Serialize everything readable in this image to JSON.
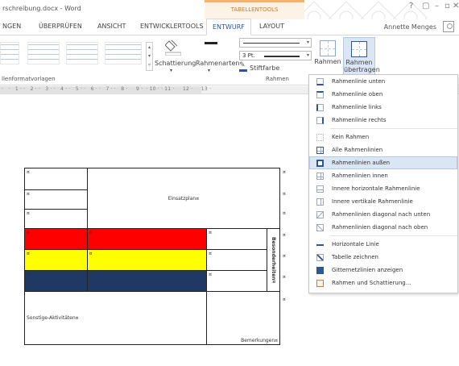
{
  "window": {
    "title": "rschreibung.docx - Word",
    "context_group": "TABELLENTOOLS",
    "controls": [
      "?",
      "▢",
      "–",
      "▫",
      "✕"
    ]
  },
  "tabs": [
    {
      "label": "NGEN"
    },
    {
      "label": "ÜBERPRÜFEN"
    },
    {
      "label": "ANSICHT"
    },
    {
      "label": "ENTWICKLERTOOLS"
    },
    {
      "label": "ENTWURF",
      "active": true
    },
    {
      "label": "LAYOUT"
    }
  ],
  "user": {
    "name": "Annette Menges"
  },
  "ribbon": {
    "shading_label": "Schattierung",
    "border_styles_label": "Rahmenarten",
    "line_weight": "3 Pt.",
    "pen_color_label": "Stiftfarbe",
    "borders_label": "Rahmen",
    "border_painter_label": "Rahmen übertragen",
    "group_styles": "llenformatvorlagen",
    "group_borders": "Rahmen",
    "colors": {
      "accent": "#2b579a",
      "context": "#f6b26b"
    }
  },
  "ruler": {
    "text": "·   ·   1 · ·   2 · ·   3 · ·   4 · ·   5 · ·   6 · ·   7 · ·   8 ·     9 ·  · 10 · · 11 ·     12 ·     13 ·"
  },
  "document": {
    "cell_mark": "¤",
    "title": "Einsatzplan¤",
    "side_label": "Besonderheiten¤",
    "activities": "Sonstige-Aktivitäten¤",
    "remarks": "Bemerkungen¤",
    "row_colors": [
      "#ff0000",
      "#ffff00",
      "#1f3864"
    ]
  },
  "menu": {
    "items": [
      {
        "label": "Rahmenlinie unten",
        "icon": "border-bottom-icon"
      },
      {
        "label": "Rahmenlinie oben",
        "icon": "border-top-icon"
      },
      {
        "label": "Rahmenlinie links",
        "icon": "border-left-icon"
      },
      {
        "label": "Rahmenlinie rechts",
        "icon": "border-right-icon"
      },
      {
        "label": "Kein Rahmen",
        "icon": "no-border-icon"
      },
      {
        "label": "Alle Rahmenlinien",
        "icon": "all-borders-icon"
      },
      {
        "label": "Rahmenlinien außen",
        "icon": "outside-borders-icon",
        "highlighted": true
      },
      {
        "label": "Rahmenlinien innen",
        "icon": "inside-borders-icon"
      },
      {
        "label": "Innere horizontale Rahmenlinie",
        "icon": "inside-horizontal-icon"
      },
      {
        "label": "Innere vertikale Rahmenlinie",
        "icon": "inside-vertical-icon"
      },
      {
        "label": "Rahmenlinien diagonal nach unten",
        "icon": "diagonal-down-icon"
      },
      {
        "label": "Rahmenlinien diagonal nach oben",
        "icon": "diagonal-up-icon"
      },
      {
        "label": "Horizontale Linie",
        "icon": "horizontal-line-icon"
      },
      {
        "label": "Tabelle zeichnen",
        "icon": "draw-table-icon"
      },
      {
        "label": "Gitternetzlinien anzeigen",
        "icon": "gridlines-icon"
      },
      {
        "label": "Rahmen und Schattierung...",
        "icon": "borders-shading-icon"
      }
    ]
  }
}
